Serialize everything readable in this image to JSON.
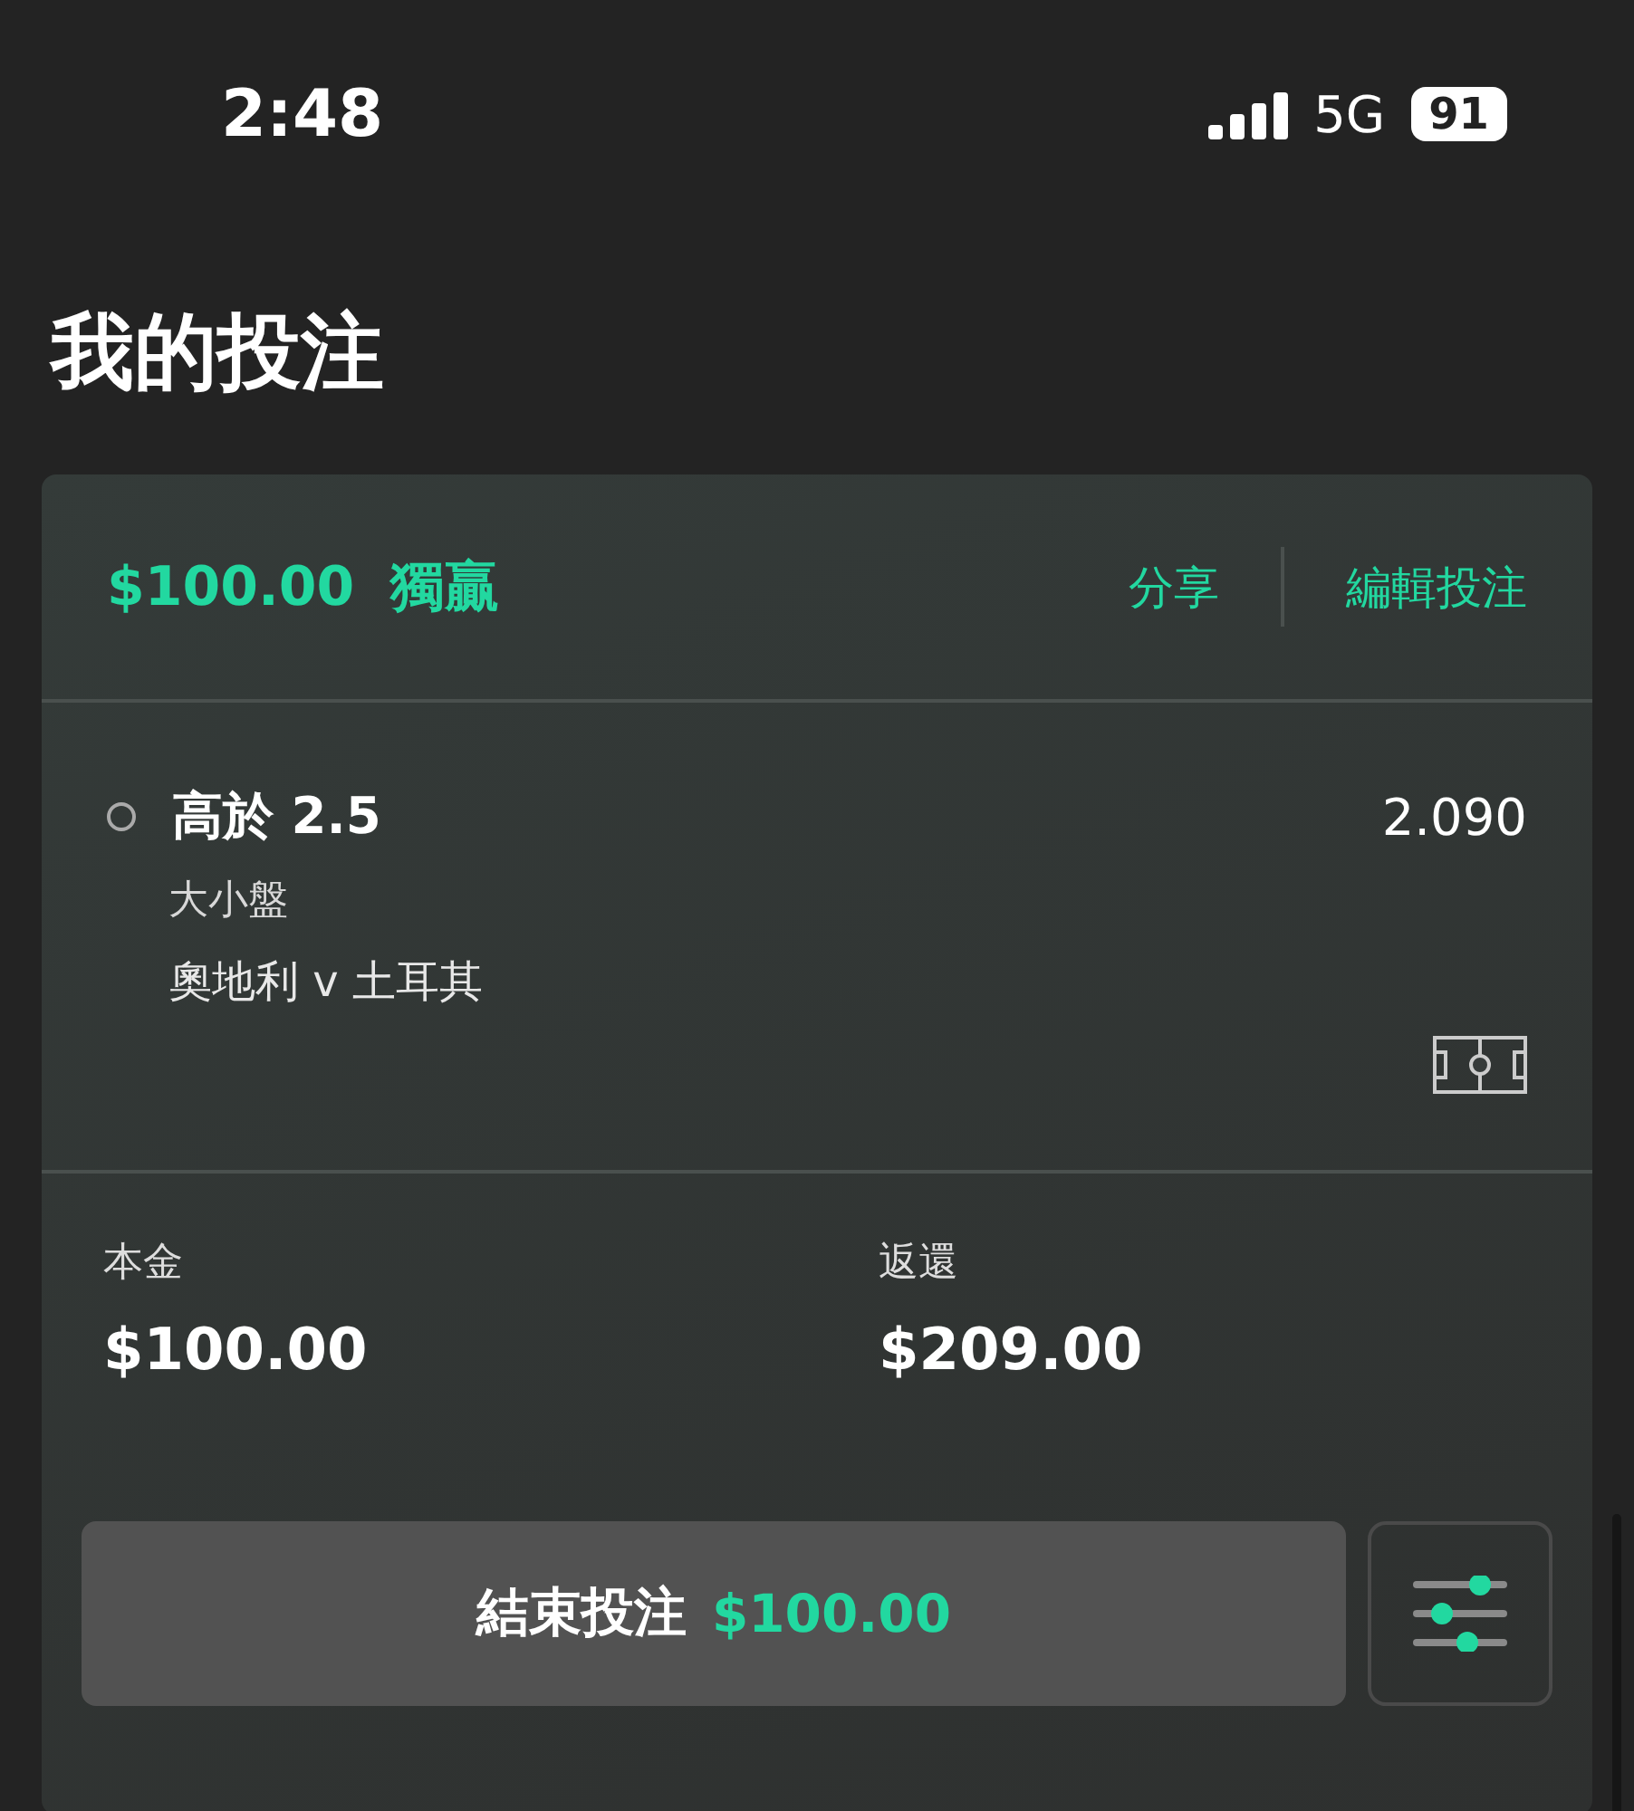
{
  "status_bar": {
    "time": "2:48",
    "network": "5G",
    "battery": "91"
  },
  "title": "我的投注",
  "bet": {
    "stake_label": "$100.00",
    "type": "獨贏",
    "actions": [
      "分享",
      "編輯投注"
    ],
    "selection": {
      "name": "高於 2.5",
      "odds": "2.090",
      "market": "大小盤",
      "event": "奧地利 v 土耳其"
    },
    "summary": [
      {
        "label": "本金",
        "value": "$100.00"
      },
      {
        "label": "返還",
        "value": "$209.00"
      }
    ],
    "cash_out": {
      "label": "結束投注",
      "amount": "$100.00"
    }
  }
}
